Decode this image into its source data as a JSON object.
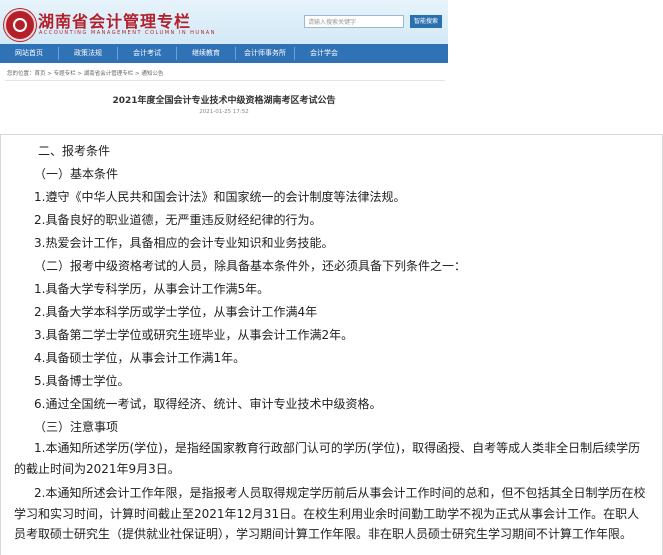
{
  "site": {
    "title": "湖南省会计管理专栏",
    "subtitle": "ACCOUNTING MANAGEMENT COLUMN IN HUNAN",
    "search_placeholder": "请输入搜索关键字",
    "search_button": "智能搜索"
  },
  "nav": [
    "网站首页",
    "政策法规",
    "会计考试",
    "继续教育",
    "会计师事务所",
    "会计学会"
  ],
  "breadcrumb": "您的位置：首页 > 专题专栏 > 湖南省会计管理专栏 > 通知公告",
  "notice": {
    "title": "2021年度全国会计专业技术中级资格湖南考区考试公告",
    "date": "2021-01-25 17:52"
  },
  "article": {
    "section_title": "二、报考条件",
    "basic_title": "（一）基本条件",
    "basic_items": [
      "1.遵守《中华人民共和国会计法》和国家统一的会计制度等法律法规。",
      "2.具备良好的职业道德，无严重违反财经纪律的行为。",
      "3.热爱会计工作，具备相应的会计专业知识和业务技能。"
    ],
    "extra_title": "（二）报考中级资格考试的人员，除具备基本条件外，还必须具备下列条件之一：",
    "extra_items": [
      "1.具备大学专科学历，从事会计工作满5年。",
      "2.具备大学本科学历或学士学位，从事会计工作满4年",
      "3.具备第二学士学位或研究生班毕业，从事会计工作满2年。",
      "4.具备硕士学位，从事会计工作满1年。",
      "5.具备博士学位。",
      "6.通过全国统一考试，取得经济、统计、审计专业技术中级资格。"
    ],
    "notes_title": "（三）注意事项",
    "notes": [
      "1.本通知所述学历(学位)，是指经国家教育行政部门认可的学历(学位)，取得函授、自考等成人类非全日制后续学历的截止时间为2021年9月3日。",
      "2.本通知所述会计工作年限，是指报考人员取得规定学历前后从事会计工作时间的总和，但不包括其全日制学历在校学习和实习时间，计算时间截止至2021年12月31日。在校生利用业余时间勤工助学不视为正式从事会计工作。在职人员考取硕士研究生（提供就业社保证明），学习期间计算工作年限。非在职人员硕士研究生学习期间不计算工作年限。"
    ]
  }
}
